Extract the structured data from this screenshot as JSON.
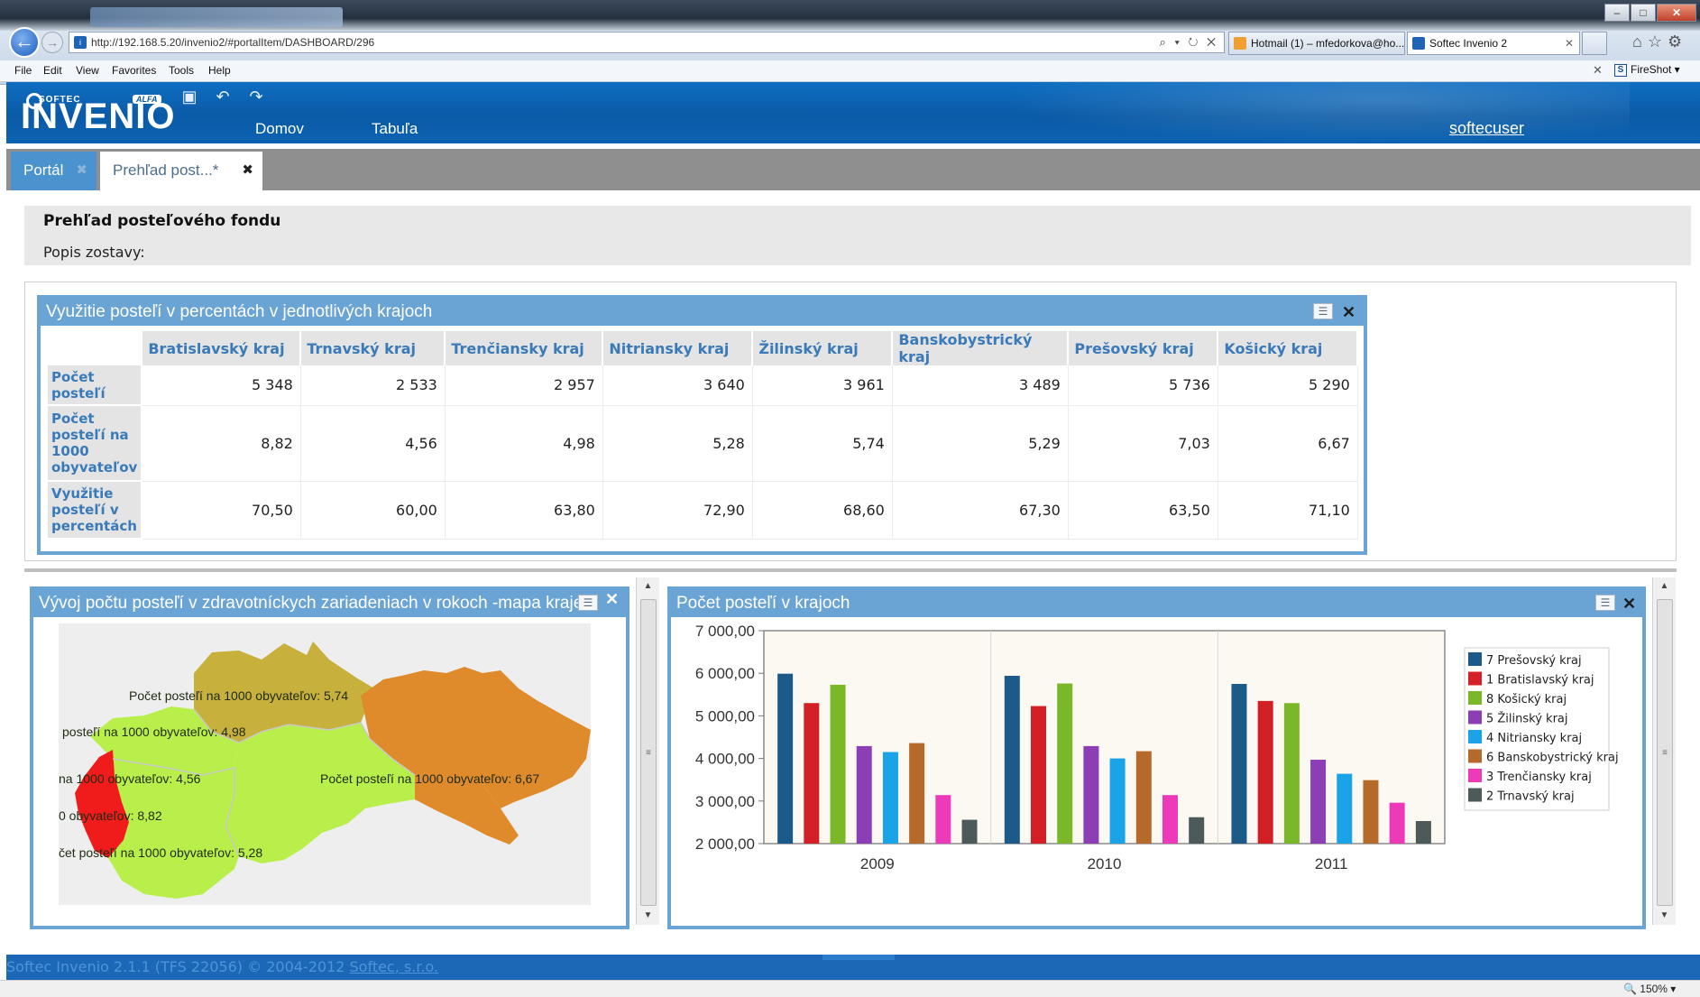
{
  "browser": {
    "url": "http://192.168.5.20/invenio2/#portalItem/DASHBOARD/296",
    "url_tools": "⌕ ▾ ↻ ✕",
    "tabs": [
      {
        "label": "Hotmail (1) – mfedorkova@ho...",
        "active": false
      },
      {
        "label": "Softec Invenio 2",
        "active": true
      }
    ],
    "menu": [
      "File",
      "Edit",
      "View",
      "Favorites",
      "Tools",
      "Help"
    ],
    "fireshot_label": "FireShot ▾",
    "zoom_label": "🔍 150% ▾"
  },
  "app": {
    "logo_brand": "SOFTEC",
    "logo_name": "INVENIO",
    "logo_badge": "ALFA",
    "nav": [
      "Domov",
      "Tabuľa"
    ],
    "user": "softecuser",
    "tabs": [
      {
        "label": "Portál",
        "active": false
      },
      {
        "label": "Prehľad post...*",
        "active": true
      }
    ]
  },
  "report": {
    "title": "Prehľad posteľového fondu",
    "description": "Popis zostavy:"
  },
  "table_portlet": {
    "title": "Využitie posteľí v percentách v jednotlivých krajoch",
    "columns": [
      "Bratislavský kraj",
      "Trnavský kraj",
      "Trenčiansky kraj",
      "Nitriansky kraj",
      "Žilinský kraj",
      "Banskobystrický kraj",
      "Prešovský kraj",
      "Košický kraj"
    ],
    "rows": [
      {
        "label": "Počet posteľí",
        "values": [
          "5 348",
          "2 533",
          "2 957",
          "3 640",
          "3 961",
          "3 489",
          "5 736",
          "5 290"
        ]
      },
      {
        "label": "Počet posteľí na 1000 obyvateľov",
        "values": [
          "8,82",
          "4,56",
          "4,98",
          "5,28",
          "5,74",
          "5,29",
          "7,03",
          "6,67"
        ]
      },
      {
        "label": "Využitie posteľí v percentách",
        "values": [
          "70,50",
          "60,00",
          "63,80",
          "72,90",
          "68,60",
          "67,30",
          "63,50",
          "71,10"
        ]
      }
    ]
  },
  "map_portlet": {
    "title": "Vývoj počtu posteľí v zdravotníckych zariadeniach v rokoch -mapa kraje",
    "labels": [
      "Počet posteľí na 1000 obyvateľov: 5,74",
      "posteľí na 1000 obyvateľov: 4,98",
      "na 1000 obyvateľov: 4,56",
      "Počet posteľí na 1000 obyvateľov: 6,67",
      "0 obyvateľov: 8,82",
      "čet posteľí na 1000 obyvateľov: 5,28"
    ],
    "region_colors": {
      "zilina": "#c7b13c",
      "kosice": "#df8a2b",
      "bratislava": "#f01c1c",
      "green": "#b9ef4b",
      "presov": "#df8a2b"
    }
  },
  "chart_portlet": {
    "title": "Počet posteľí v krajoch"
  },
  "chart_data": {
    "type": "bar",
    "categories": [
      "2009",
      "2010",
      "2011"
    ],
    "ylim": [
      2000,
      7000
    ],
    "yticks": [
      "2 000,00",
      "3 000,00",
      "4 000,00",
      "5 000,00",
      "6 000,00",
      "7 000,00"
    ],
    "ytick_values": [
      2000,
      3000,
      4000,
      5000,
      6000,
      7000
    ],
    "legend_position": "right",
    "series": [
      {
        "name": "7 Prešovský kraj",
        "color": "#1c5a8a",
        "values": [
          5990,
          5940,
          5750
        ]
      },
      {
        "name": "1 Bratislavský kraj",
        "color": "#d32026",
        "values": [
          5300,
          5230,
          5350
        ]
      },
      {
        "name": "8 Košický kraj",
        "color": "#7ab829",
        "values": [
          5730,
          5760,
          5300
        ]
      },
      {
        "name": "5 Žilinský kraj",
        "color": "#8c3fb5",
        "values": [
          4290,
          4290,
          3970
        ]
      },
      {
        "name": "4 Nitriansky kraj",
        "color": "#1aa3e6",
        "values": [
          4150,
          4000,
          3640
        ]
      },
      {
        "name": "6 Banskobystrický kraj",
        "color": "#b5692a",
        "values": [
          4360,
          4170,
          3490
        ]
      },
      {
        "name": "3 Trenčiansky kraj",
        "color": "#ec3ab8",
        "values": [
          3140,
          3140,
          2960
        ]
      },
      {
        "name": "2 Trnavský kraj",
        "color": "#4d5a5a",
        "values": [
          2560,
          2620,
          2530
        ]
      }
    ]
  },
  "footer": {
    "text": "Softec Invenio 2.1.1 (TFS 22056) © 2004-2012 ",
    "link": "Softec, s.r.o."
  }
}
